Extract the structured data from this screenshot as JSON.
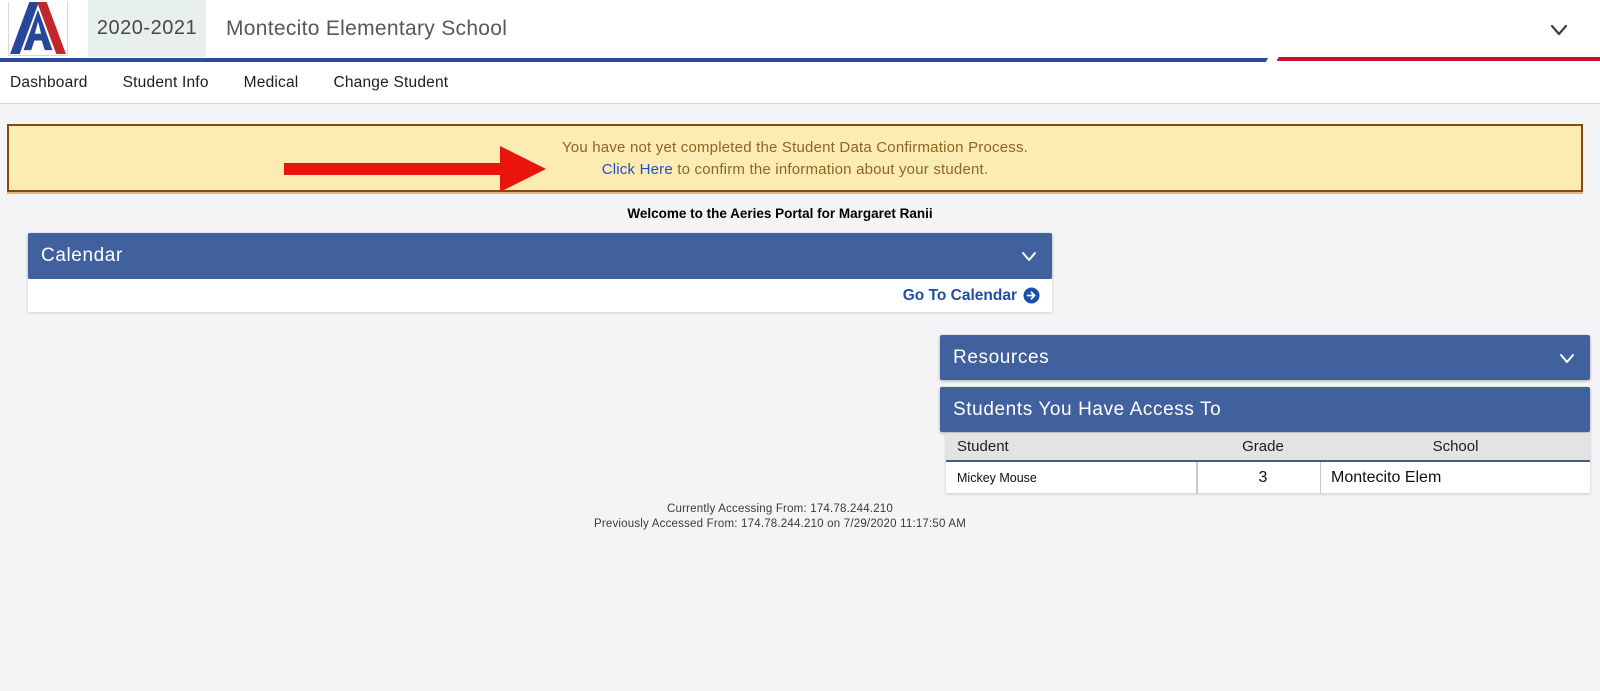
{
  "header": {
    "year": "2020-2021",
    "school_name": "Montecito Elementary School"
  },
  "nav": {
    "items": [
      "Dashboard",
      "Student Info",
      "Medical",
      "Change Student"
    ]
  },
  "banner": {
    "line1": "You have not yet completed the Student Data Confirmation Process.",
    "link_text": "Click Here",
    "line2_rest": " to confirm the information about your student."
  },
  "welcome_text": "Welcome to the Aeries Portal for Margaret Ranii",
  "calendar": {
    "title": "Calendar",
    "go_to_link": "Go To Calendar"
  },
  "resources": {
    "title": "Resources"
  },
  "students_panel": {
    "title": "Students You Have Access To",
    "columns": [
      "Student",
      "Grade",
      "School"
    ],
    "rows": [
      {
        "student": "Mickey Mouse",
        "grade": "3",
        "school": "Montecito Elem"
      }
    ]
  },
  "footer": {
    "current_access": "Currently Accessing From: 174.78.244.210",
    "previous_access": "Previously Accessed From: 174.78.244.210 on 7/29/2020 11:17:50 AM"
  },
  "icons": {
    "topbar_dropdown": "chevron-down",
    "calendar_collapse": "chevron-down",
    "resources_collapse": "chevron-down",
    "go_to_calendar": "arrow-right-circle",
    "annotation": "red-arrow-right"
  },
  "colors": {
    "panel_blue": "#41619e",
    "divider_blue": "#2a4b9e",
    "divider_red": "#cb112d",
    "banner_bg": "#fdecb2",
    "banner_border": "#8a4613",
    "banner_text": "#8d6524",
    "link_blue": "#1d50c8",
    "goto_link_blue": "#1d4fa8",
    "logo_blue": "#27479b",
    "logo_red": "#c1272d",
    "arrow_red": "#ea150d",
    "page_bg": "#f4f4f6"
  }
}
